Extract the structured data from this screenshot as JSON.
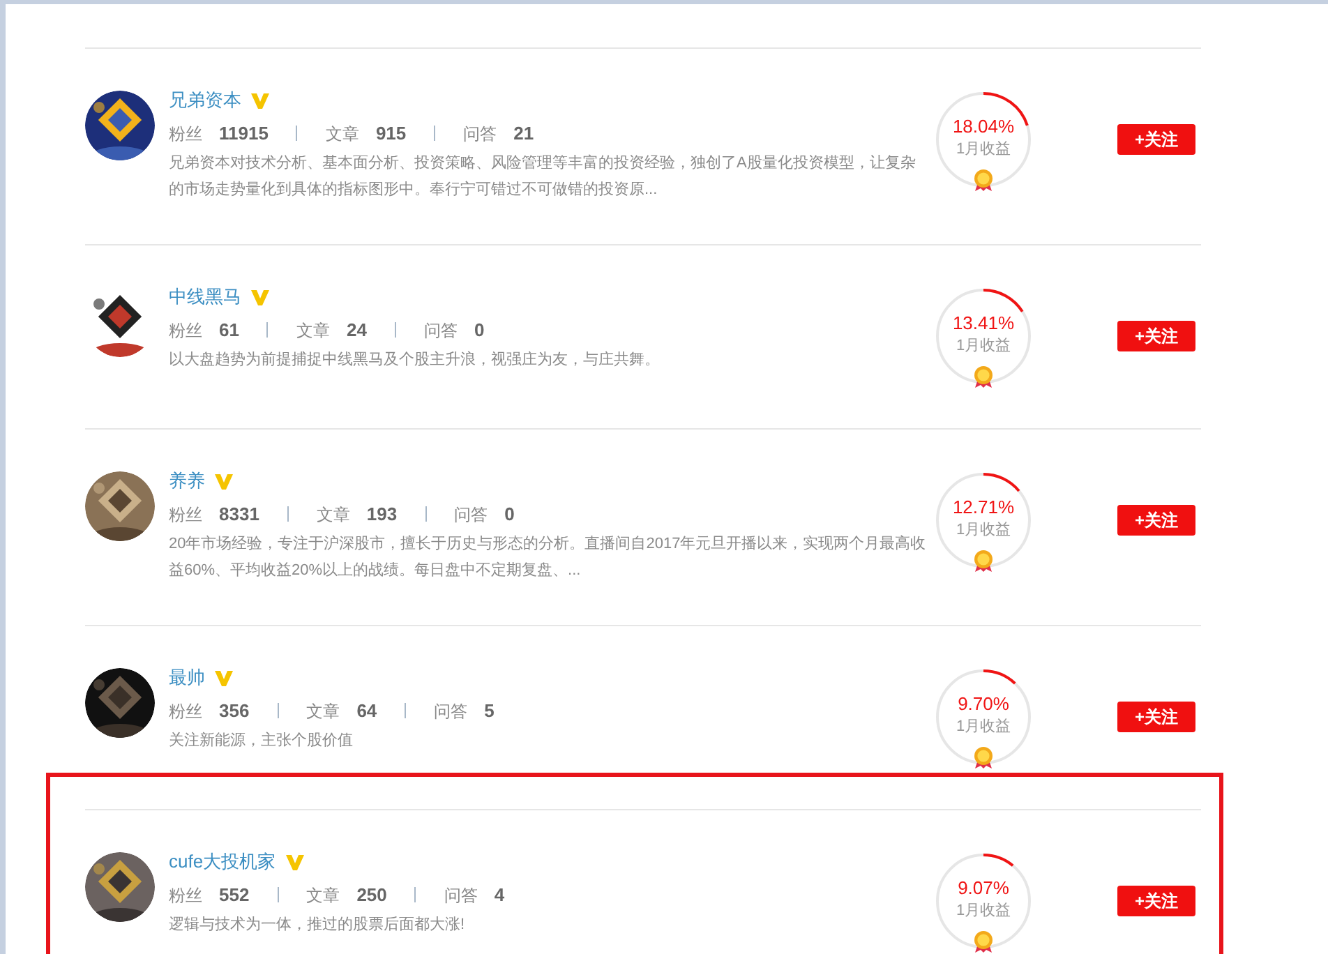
{
  "items": [
    {
      "name": "兄弟资本",
      "verified": true,
      "stats": [
        {
          "label": "粉丝",
          "value": "11915"
        },
        {
          "label": "文章",
          "value": "915"
        },
        {
          "label": "问答",
          "value": "21"
        }
      ],
      "description": "兄弟资本对技术分析、基本面分析、投资策略、风险管理等丰富的投资经验，独创了A股量化投资模型，让复杂的市场走势量化到具体的指标图形中。奉行宁可错过不可做错的投资原...",
      "return": "18.04%",
      "return_label": "1月收益",
      "level": 0.2,
      "follow": "+关注",
      "highlighted": false
    },
    {
      "name": "中线黑马",
      "verified": true,
      "stats": [
        {
          "label": "粉丝",
          "value": "61"
        },
        {
          "label": "文章",
          "value": "24"
        },
        {
          "label": "问答",
          "value": "0"
        }
      ],
      "description": "以大盘趋势为前提捕捉中线黑马及个股主升浪，视强庄为友，与庄共舞。",
      "return": "13.41%",
      "return_label": "1月收益",
      "level": 0.16,
      "follow": "+关注",
      "highlighted": false
    },
    {
      "name": "养养",
      "verified": true,
      "stats": [
        {
          "label": "粉丝",
          "value": "8331"
        },
        {
          "label": "文章",
          "value": "193"
        },
        {
          "label": "问答",
          "value": "0"
        }
      ],
      "description": "20年市场经验，专注于沪深股市，擅长于历史与形态的分析。直播间自2017年元旦开播以来，实现两个月最高收益60%、平均收益20%以上的战绩。每日盘中不定期复盘、...",
      "return": "12.71%",
      "return_label": "1月收益",
      "level": 0.14,
      "follow": "+关注",
      "highlighted": false
    },
    {
      "name": "最帅",
      "verified": true,
      "stats": [
        {
          "label": "粉丝",
          "value": "356"
        },
        {
          "label": "文章",
          "value": "64"
        },
        {
          "label": "问答",
          "value": "5"
        }
      ],
      "description": "关注新能源，主张个股价值",
      "return": "9.70%",
      "return_label": "1月收益",
      "level": 0.12,
      "follow": "+关注",
      "highlighted": false
    },
    {
      "name": "cufe大投机家",
      "verified": true,
      "stats": [
        {
          "label": "粉丝",
          "value": "552"
        },
        {
          "label": "文章",
          "value": "250"
        },
        {
          "label": "问答",
          "value": "4"
        }
      ],
      "description": "逻辑与技术为一体，推过的股票后面都大涨!",
      "return": "9.07%",
      "return_label": "1月收益",
      "level": 0.11,
      "follow": "+关注",
      "highlighted": true
    }
  ]
}
